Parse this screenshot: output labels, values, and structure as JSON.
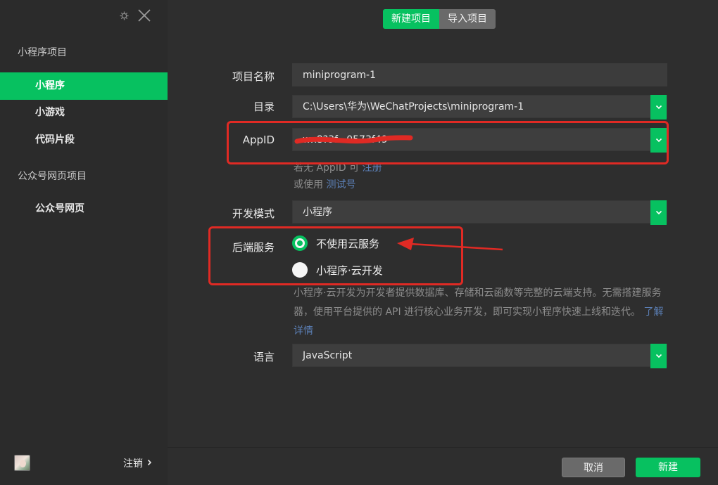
{
  "sidebar": {
    "groups": [
      {
        "title": "小程序项目",
        "items": [
          "小程序",
          "小游戏",
          "代码片段"
        ]
      },
      {
        "title": "公众号网页项目",
        "items": [
          "公众号网页"
        ]
      }
    ],
    "active_item": "小程序",
    "footer": {
      "logout_label": "注销"
    }
  },
  "tabs": {
    "new_project": "新建项目",
    "import_project": "导入项目"
  },
  "form": {
    "project_name": {
      "label": "项目名称",
      "value": "miniprogram-1"
    },
    "directory": {
      "label": "目录",
      "value": "C:\\Users\\华为\\WeChatProjects\\miniprogram-1"
    },
    "appid": {
      "label": "AppID",
      "value": "wx8?3f...0573f49",
      "hint_prefix": "若无 AppID 可",
      "hint_register": "注册",
      "hint2_prefix": "或使用",
      "hint2_link": "测试号"
    },
    "dev_mode": {
      "label": "开发模式",
      "value": "小程序"
    },
    "backend": {
      "label": "后端服务",
      "options": [
        "不使用云服务",
        "小程序·云开发"
      ],
      "selected": 0,
      "description": "小程序·云开发为开发者提供数据库、存储和云函数等完整的云端支持。无需搭建服务器，使用平台提供的 API 进行核心业务开发，即可实现小程序快速上线和迭代。",
      "learn_more": "了解详情"
    },
    "language": {
      "label": "语言",
      "value": "JavaScript"
    }
  },
  "buttons": {
    "cancel": "取消",
    "create": "新建"
  },
  "colors": {
    "accent": "#07c160",
    "annotation_red": "#e02a24",
    "link": "#5b7fb5"
  }
}
